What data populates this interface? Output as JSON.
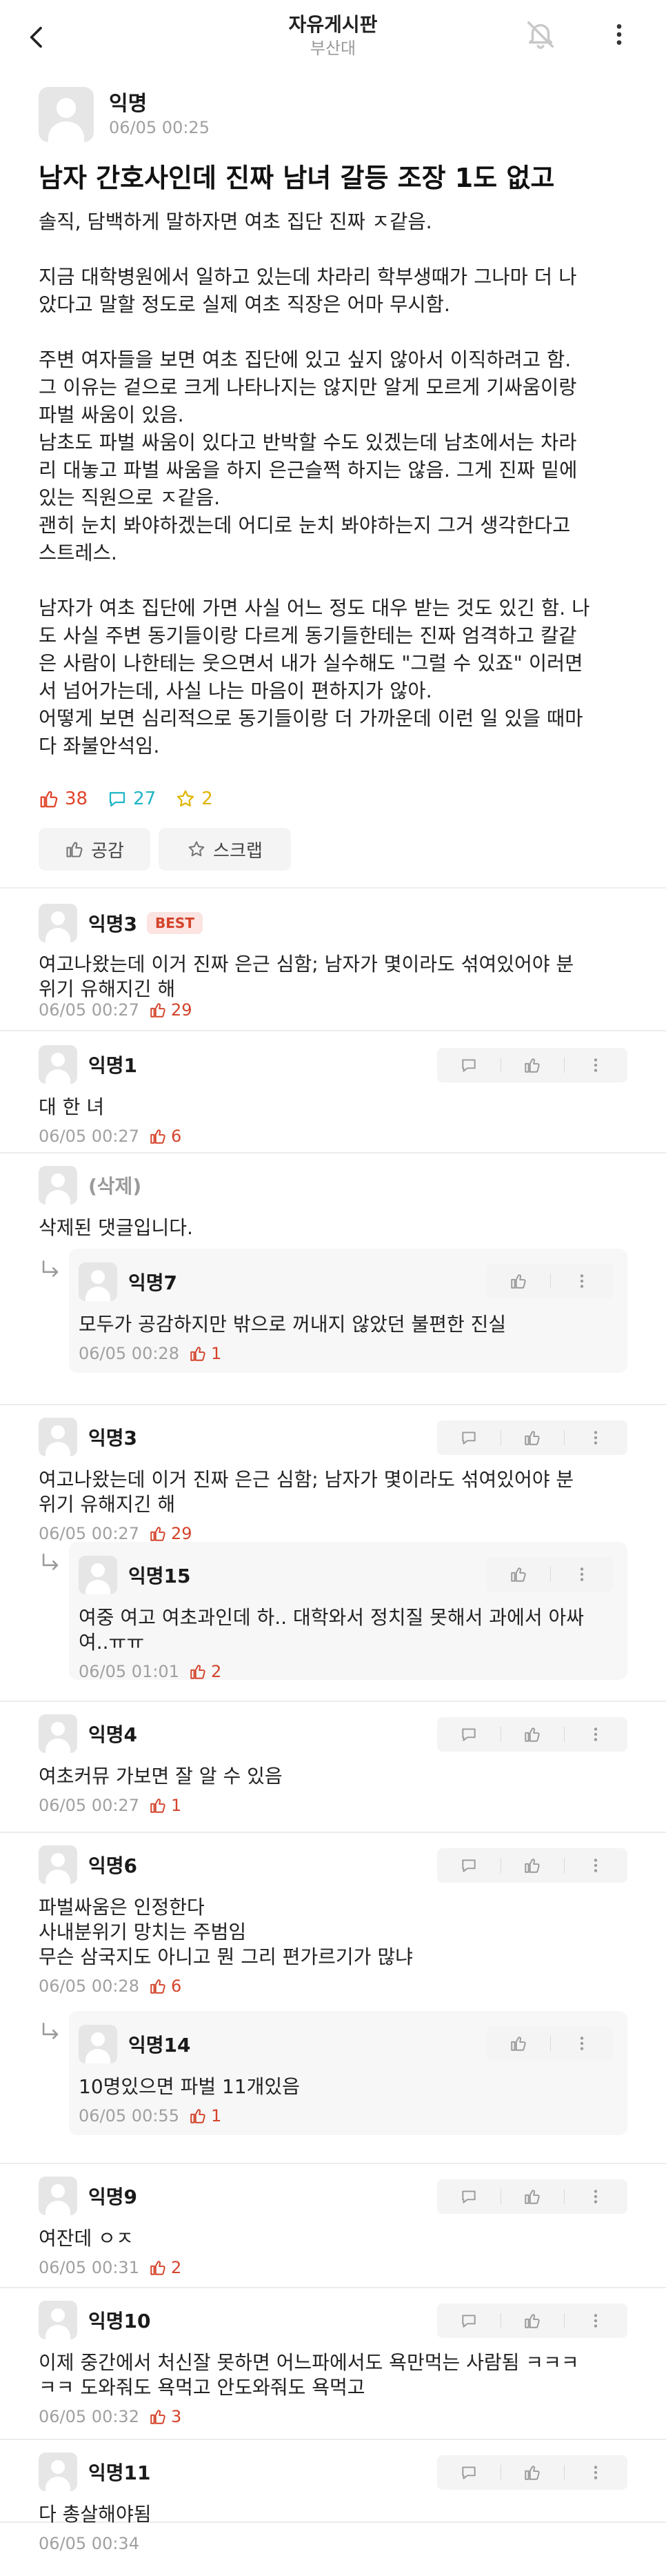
{
  "header": {
    "title": "자유게시판",
    "subtitle": "부산대",
    "back_icon": "chevron-left-icon",
    "bell_icon": "bell-off-icon",
    "more_icon": "more-vertical-icon"
  },
  "post": {
    "author": "익명",
    "time": "06/05 00:25",
    "title": "남자 간호사인데 진짜 남녀 갈등 조장 1도 없고",
    "body": [
      "솔직, 담백하게 말하자면 여초 집단 진짜 ㅈ같음.",
      "",
      "지금 대학병원에서 일하고 있는데 차라리 학부생때가 그나마 더 나",
      "았다고 말할 정도로 실제 여초 직장은 어마 무시함.",
      "",
      "주변 여자들을 보면 여초 집단에 있고 싶지 않아서 이직하려고 함.",
      "그 이유는 겉으로 크게 나타나지는 않지만 알게 모르게 기싸움이랑",
      "파벌 싸움이 있음.",
      "남초도 파벌 싸움이 있다고 반박할 수도 있겠는데 남초에서는 차라",
      "리 대놓고 파벌 싸움을 하지 은근슬쩍 하지는 않음. 그게 진짜 밑에",
      "있는 직원으로 ㅈ같음.",
      "괜히 눈치 봐야하겠는데 어디로 눈치 봐야하는지 그거 생각한다고",
      "스트레스.",
      "",
      "남자가 여초 집단에 가면 사실 어느 정도 대우 받는 것도 있긴 함. 나",
      "도 사실 주변 동기들이랑 다르게 동기들한테는 진짜 엄격하고 칼같",
      "은 사람이 나한테는 웃으면서 내가 실수해도 \"그럴 수 있죠\" 이러면",
      "서 넘어가는데, 사실 나는 마음이 편하지가 않아.",
      "어떻게 보면 심리적으로 동기들이랑 더 가까운데 이런 일 있을 때마",
      "다 좌불안석임."
    ],
    "likes": "38",
    "comments": "27",
    "scraps": "2",
    "empathy_label": "공감",
    "scrap_label": "스크랩"
  },
  "best_comment": {
    "author": "익명3",
    "badge": "BEST",
    "lines": [
      "여고나왔는데 이거 진짜 은근 심함; 남자가 몇이라도 섞여있어야 분",
      "위기 유해지긴 해"
    ],
    "time": "06/05 00:27",
    "likes": "29"
  },
  "comments": [
    {
      "author": "익명1",
      "lines": [
        "대 한 녀"
      ],
      "time": "06/05 00:27",
      "likes": "6"
    },
    {
      "author": "(삭제)",
      "lines": [
        "삭제된 댓글입니다."
      ]
    },
    {
      "author": "익명7",
      "lines": [
        "모두가 공감하지만 밖으로 꺼내지 않았던 불편한 진실"
      ],
      "time": "06/05 00:28",
      "likes": "1"
    },
    {
      "author": "익명3",
      "lines": [
        "여고나왔는데 이거 진짜 은근 심함; 남자가 몇이라도 섞여있어야 분",
        "위기 유해지긴 해"
      ],
      "time": "06/05 00:27",
      "likes": "29"
    },
    {
      "author": "익명15",
      "lines": [
        "여중 여고 여초과인데 하.. 대학와서 정치질 못해서 과에서 아싸",
        "여..ㅠㅠ"
      ],
      "time": "06/05 01:01",
      "likes": "2"
    },
    {
      "author": "익명4",
      "lines": [
        "여초커뮤 가보면 잘 알 수 있음"
      ],
      "time": "06/05 00:27",
      "likes": "1"
    },
    {
      "author": "익명6",
      "lines": [
        "파벌싸움은 인정한다",
        "사내분위기 망치는 주범임",
        "무슨 삼국지도 아니고 뭔 그리 편가르기가 많냐"
      ],
      "time": "06/05 00:28",
      "likes": "6"
    },
    {
      "author": "익명14",
      "lines": [
        "10명있으면 파벌 11개있음"
      ],
      "time": "06/05 00:55",
      "likes": "1"
    },
    {
      "author": "익명9",
      "lines": [
        "여잔데 ㅇㅈ"
      ],
      "time": "06/05 00:31",
      "likes": "2"
    },
    {
      "author": "익명10",
      "lines": [
        "이제 중간에서 처신잘 못하면 어느파에서도 욕만먹는 사람됨 ㅋㅋㅋ",
        "ㅋㅋ 도와줘도 욕먹고 안도와줘도 욕먹고"
      ],
      "time": "06/05 00:32",
      "likes": "3"
    },
    {
      "author": "익명11",
      "lines": [
        "다 총살해야됨"
      ],
      "time": "06/05 00:34"
    }
  ]
}
